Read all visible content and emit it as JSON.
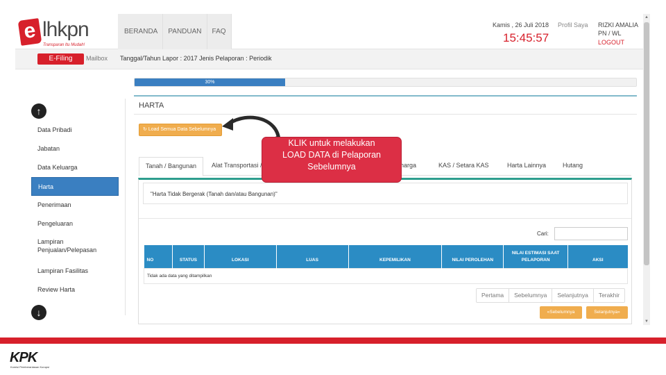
{
  "header": {
    "logo_e": "e",
    "logo_text": "lhkpn",
    "logo_tagline": "Transparan Itu Mudah!",
    "nav": [
      "BERANDA",
      "PANDUAN",
      "FAQ"
    ],
    "date": "Kamis , 26 Juli 2018",
    "clock": "15:45:57",
    "profile_label": "Profil Saya",
    "user_name": "RIZKI AMALIA",
    "user_role": "PN / WL",
    "logout_label": "LOGOUT"
  },
  "subbar": {
    "efiling_label": "E-Filing",
    "mailbox_label": "Mailbox",
    "report_info": "Tanggal/Tahun Lapor : 2017   Jenis Pelaporan : Periodik"
  },
  "progress": {
    "value_percent": 30,
    "label": "30%"
  },
  "sidebar": {
    "items": [
      {
        "label": "Data Pribadi"
      },
      {
        "label": "Jabatan"
      },
      {
        "label": "Data Keluarga"
      },
      {
        "label": "Harta"
      },
      {
        "label": "Penerimaan"
      },
      {
        "label": "Pengeluaran"
      },
      {
        "label": "Lampiran Penjualan/Pelepasan"
      },
      {
        "label": "Lampiran Fasilitas"
      },
      {
        "label": "Review Harta"
      }
    ],
    "active_index": 3
  },
  "content": {
    "section_title": "HARTA",
    "load_button": "Load Semua Data Sebelumnya",
    "tabs": [
      "Tanah / Bangunan",
      "Alat Transportasi /",
      "erharga",
      "KAS / Setara KAS",
      "Harta Lainnya",
      "Hutang"
    ],
    "description": "\"Harta Tidak Bergerak (Tanah dan/atau Bangunan)\"",
    "search_label": "Cari:",
    "search_value": "",
    "table_headers": [
      "NO",
      "STATUS",
      "LOKASI",
      "LUAS",
      "KEPEMILIKAN",
      "NILAI PEROLEHAN",
      "NILAI ESTIMASI SAAT PELAPORAN",
      "AKSI"
    ],
    "empty_message": "Tidak ada data yang ditampilkan",
    "pager": [
      "Pertama",
      "Sebelumnya",
      "Selanjutnya",
      "Terakhir"
    ],
    "prev_button": "Sebelumnya",
    "next_button": "Selanjutnya"
  },
  "callout": {
    "line1": "KLIK untuk melakukan",
    "line2": "LOAD DATA di Pelaporan",
    "line3": "Sebelumnya"
  },
  "footer": {
    "logo_text": "KPK",
    "logo_sub": "Komisi Pemberantasan Korupsi"
  },
  "colors": {
    "brand_red": "#d7202b",
    "primary_blue": "#3a7fc1",
    "table_header_blue": "#2b8cc4",
    "warning_orange": "#f0ad4e",
    "callout_red": "#dc2f45"
  }
}
